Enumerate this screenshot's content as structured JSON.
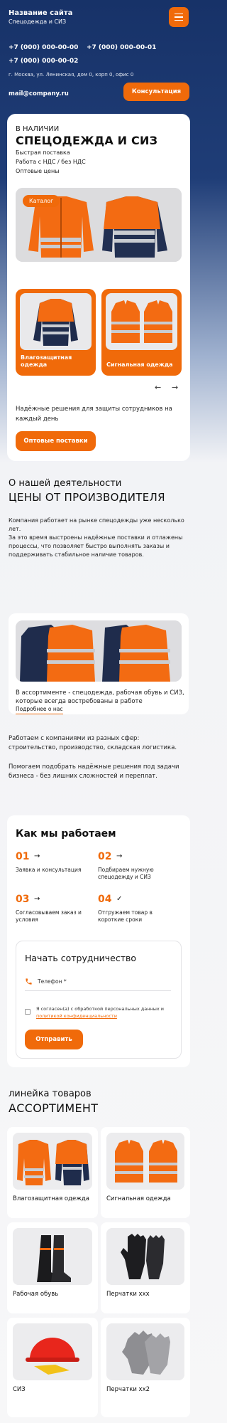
{
  "header": {
    "title": "Название сайта",
    "subtitle": "Спецодежда и СИЗ",
    "phone1": "+7 (000) 000-00-00",
    "phone2": "+7 (000) 000-00-01",
    "phone3": "+7 (000) 000-00-02",
    "address": "г. Москва, ул. Ленинская, дом 0, корп 0, офис 0",
    "email": "mail@company.ru",
    "consult_label": "Консультация",
    "menu_icon": "burger-menu-icon"
  },
  "hero": {
    "kicker": "В НАЛИЧИИ",
    "title": "СПЕЦОДЕЖДА И СИЗ",
    "features": [
      "Быстрая поставка",
      "Работа с НДС / без НДС",
      "Оптовые цены"
    ],
    "catalog_badge": "Каталог",
    "cards": [
      {
        "label": "Влагозащитная одежда"
      },
      {
        "label": "Сигнальная одежда"
      }
    ],
    "prev_arrow": "←",
    "next_arrow": "→",
    "tagline": "Надёжные решения для защиты сотрудников на каждый день",
    "cta": "Оптовые поставки"
  },
  "about": {
    "kicker": "О нашей деятельности",
    "title": "ЦЕНЫ ОТ ПРОИЗВОДИТЕЛЯ",
    "p1": "Компания работает на рынке спецодежды уже несколько лет.",
    "p2": "За это время выстроены надёжные поставки и отлажены процессы, что позволяет быстро выполнять заказы и поддерживать стабильное наличие товаров.",
    "card_text": "В ассортименте - спецодежда, рабочая обувь и СИЗ, которые всегда востребованы в работе",
    "more_link": "Подробнее о нас",
    "p3": "Работаем с компаниями из разных сфер: строительство, производство, складская логистика.",
    "p4": "Помогаем подобрать надёжные решения под задачи бизнеса - без лишних сложностей и переплат."
  },
  "how": {
    "title": "Как мы работаем",
    "steps": [
      {
        "num": "01",
        "label": "Заявка и консультация"
      },
      {
        "num": "02",
        "label": "Подбираем нужную спецодежду и СИЗ"
      },
      {
        "num": "03",
        "label": "Согласовываем заказ и условия"
      },
      {
        "num": "04",
        "label": "Отгружаем товар в короткие сроки"
      }
    ]
  },
  "form": {
    "title": "Начать сотрудничество",
    "phone_label": "Телефон *",
    "consent_text": "Я согласен(а) с обработкой персональных данных и",
    "consent_link": "политикой конфиденциальности",
    "submit": "Отправить"
  },
  "assortment": {
    "kicker": "линейка товаров",
    "title": "АССОРТИМЕНТ",
    "products": [
      {
        "name": "Влагозащитная одежда"
      },
      {
        "name": "Сигнальная одежда"
      },
      {
        "name": "Рабочая обувь"
      },
      {
        "name": "Перчатки ххх"
      },
      {
        "name": "СИЗ"
      },
      {
        "name": "Перчатки хх2"
      }
    ]
  },
  "colors": {
    "accent": "#f06a0a",
    "header_bg": "#1f3d77"
  }
}
